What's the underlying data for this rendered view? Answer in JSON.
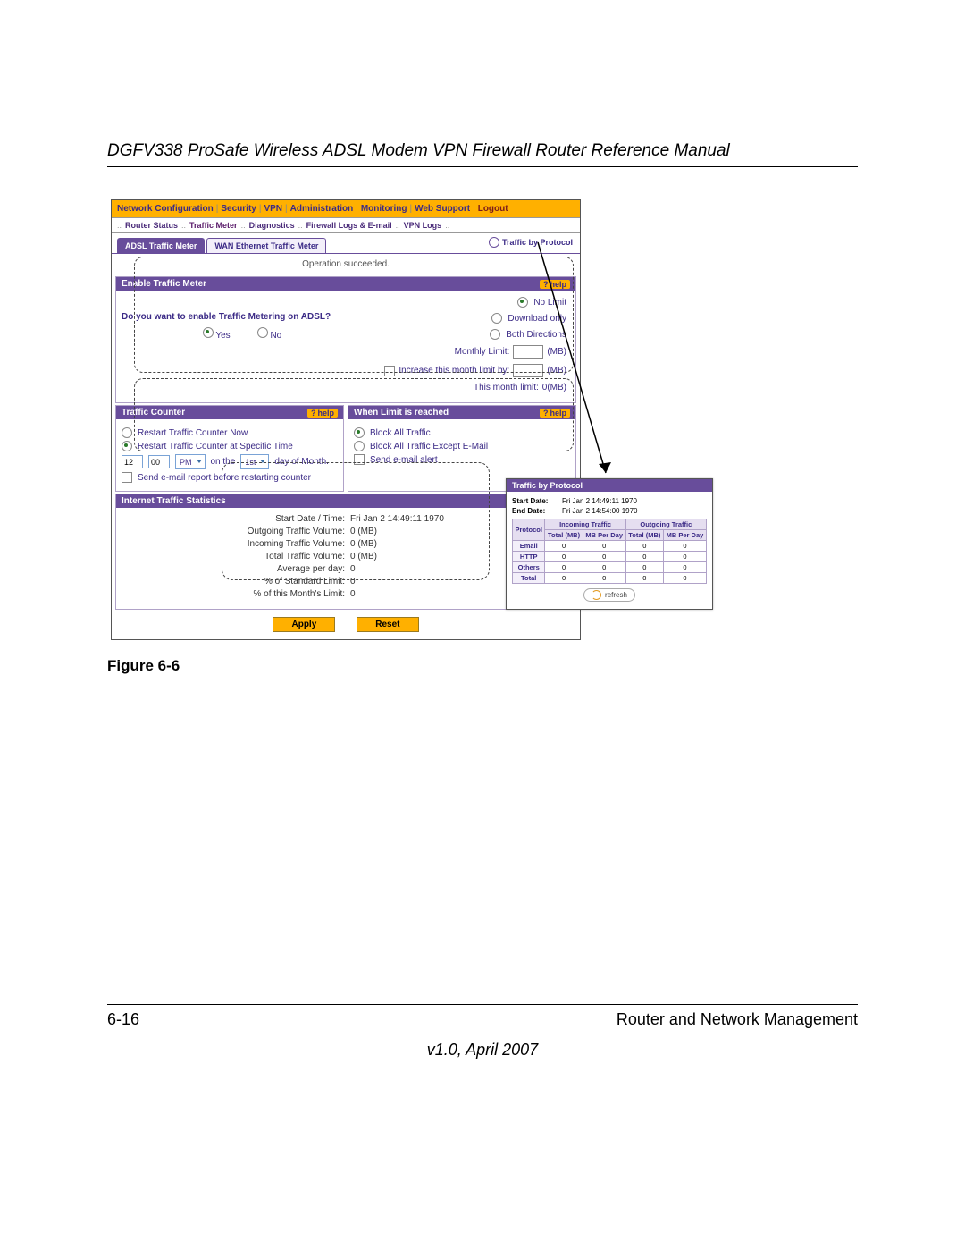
{
  "doc_title": "DGFV338 ProSafe Wireless ADSL Modem VPN Firewall Router Reference Manual",
  "figure_caption": "Figure 6-6",
  "footer_page": "6-16",
  "footer_section": "Router and Network Management",
  "footer_version": "v1.0, April 2007",
  "nav": {
    "items": [
      "Network Configuration",
      "Security",
      "VPN",
      "Administration",
      "Monitoring",
      "Web Support",
      "Logout"
    ]
  },
  "subnav": {
    "items": [
      "Router Status",
      "Traffic Meter",
      "Diagnostics",
      "Firewall Logs & E-mail",
      "VPN Logs"
    ]
  },
  "tabs": {
    "active": "ADSL Traffic Meter",
    "other": "WAN Ethernet Traffic Meter",
    "link": "Traffic by Protocol"
  },
  "status_msg": "Operation succeeded.",
  "panels": {
    "etm": {
      "title": "Enable Traffic Meter",
      "question": "Do you want to enable Traffic Metering on ADSL?",
      "yes": "Yes",
      "no": "No",
      "opts": {
        "no_limit": "No Limit",
        "download_only": "Download only",
        "both": "Both Directions"
      },
      "monthly_limit_label": "Monthly Limit:",
      "mb": "(MB)",
      "increase_label": "Increase this month limit by:",
      "this_month_label": "This month limit:",
      "this_month_value": "0(MB)"
    },
    "tc": {
      "title": "Traffic Counter",
      "restart_now": "Restart Traffic Counter Now",
      "restart_at": "Restart Traffic Counter at Specific Time",
      "time_h": "12",
      "time_m": "00",
      "ampm": "PM",
      "on_the": "on the",
      "day": "1st",
      "day_suffix": "day of Month.",
      "send_report": "Send e-mail report before restarting counter"
    },
    "wl": {
      "title": "When Limit is reached",
      "block_all": "Block All Traffic",
      "block_mail": "Block All Traffic Except E-Mail",
      "send_alert": "Send e-mail alert"
    },
    "stats": {
      "title": "Internet Traffic Statistics",
      "rows": {
        "start": "Start Date / Time:",
        "start_v": "Fri Jan 2 14:49:11 1970",
        "out": "Outgoing Traffic Volume:",
        "out_v": "0 (MB)",
        "in": "Incoming Traffic Volume:",
        "in_v": "0 (MB)",
        "tot": "Total Traffic Volume:",
        "tot_v": "0 (MB)",
        "avg": "Average per day:",
        "avg_v": "0",
        "std": "% of Standard Limit:",
        "std_v": "0",
        "mon": "% of this Month's Limit:",
        "mon_v": "0"
      }
    }
  },
  "buttons": {
    "apply": "Apply",
    "reset": "Reset"
  },
  "help_label": "help",
  "popup": {
    "title": "Traffic by Protocol",
    "start_date_label": "Start Date:",
    "start_date": "Fri Jan 2 14:49:11 1970",
    "end_date_label": "End Date:",
    "end_date": "Fri Jan 2 14:54:00 1970",
    "col_proto": "Protocol",
    "col_in": "Incoming Traffic",
    "col_out": "Outgoing Traffic",
    "sub_total": "Total (MB)",
    "sub_perday": "MB Per Day",
    "rows": [
      {
        "p": "Email",
        "a": "0",
        "b": "0",
        "c": "0",
        "d": "0"
      },
      {
        "p": "HTTP",
        "a": "0",
        "b": "0",
        "c": "0",
        "d": "0"
      },
      {
        "p": "Others",
        "a": "0",
        "b": "0",
        "c": "0",
        "d": "0"
      },
      {
        "p": "Total",
        "a": "0",
        "b": "0",
        "c": "0",
        "d": "0"
      }
    ],
    "refresh": "refresh"
  }
}
